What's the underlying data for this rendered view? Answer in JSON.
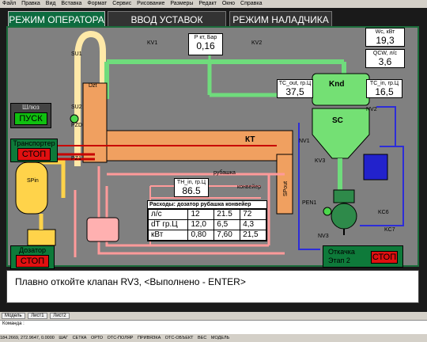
{
  "menu": {
    "items": [
      "Файл",
      "Правка",
      "Вид",
      "Вставка",
      "Формат",
      "Сервис",
      "Рисование",
      "Размеры",
      "Редакт",
      "Окно",
      "Справка"
    ]
  },
  "tabs": [
    {
      "label": "РЕЖИМ ОПЕРАТОРА"
    },
    {
      "label": "ВВОД УСТАВОК"
    },
    {
      "label": "РЕЖИМ НАЛАДЧИКА"
    }
  ],
  "readouts": {
    "pressure": {
      "label": "Р кт, Бар",
      "value": "0,16"
    },
    "power": {
      "label": "Wc, кВт",
      "value": "19,3"
    },
    "flow": {
      "label": "QCW, л/с",
      "value": "3,6"
    },
    "tc_out": {
      "label": "TC_out, гр.Ц",
      "value": "37,5"
    },
    "tc_in": {
      "label": "TC_in, гр.Ц",
      "value": "16,5"
    },
    "th_in": {
      "label": "TH_in, гр.Ц",
      "value": "86.5"
    }
  },
  "labels": {
    "kv1": "KV1",
    "kv2": "KV2",
    "su1": "SU1",
    "su2": "SU2",
    "pzd": "PZD",
    "pz1": "PZ1",
    "dzt": "Dzt",
    "kt": "КТ",
    "knd": "Knd",
    "sc": "SC",
    "nv1": "NV1",
    "nv2": "NV2",
    "kv3": "KV3",
    "spin": "SPin",
    "spout": "SPout",
    "rubashka": "рубашка",
    "konveier": "конвейер",
    "pen1": "PEN1",
    "nv3": "NV3",
    "kc6": "KC6",
    "kc7": "KC7"
  },
  "controls": {
    "shluz": {
      "title": "Шлюз",
      "button": "ПУСК"
    },
    "transporter": {
      "title": "Транспортер",
      "button": "СТОП"
    },
    "dozator": {
      "title": "Дозатор",
      "button": "СТОП"
    },
    "otkachka": {
      "title1": "Откачка",
      "title2": "Этап 2",
      "button": "СТОП"
    }
  },
  "consumption": {
    "header": "Расходы: дозатор рубашка конвейер",
    "rows": [
      {
        "unit": "л/с",
        "c1": "12",
        "c2": "21.5",
        "c3": "72"
      },
      {
        "unit": "dT гр.Ц",
        "c1": "12,0",
        "c2": "6,5",
        "c3": "4,3"
      },
      {
        "unit": "кВт",
        "c1": "0,80",
        "c2": "7,60",
        "c3": "21,5"
      }
    ]
  },
  "message": "Плавно откойте клапан RV3, <Выполнено - ENTER>",
  "bottom_tabs": [
    "Модель",
    "Лист1",
    "Лист2"
  ],
  "command": "Команда :",
  "status": {
    "coords": "184.2669, 272.9647, 0.0000",
    "modes": [
      "ШАГ",
      "СЕТКА",
      "ОРТО",
      "ОТС-ПОЛЯР",
      "ПРИВЯЗКА",
      "ОТС-ОБЪЕКТ",
      "ВЕС",
      "МОДЕЛЬ"
    ]
  }
}
